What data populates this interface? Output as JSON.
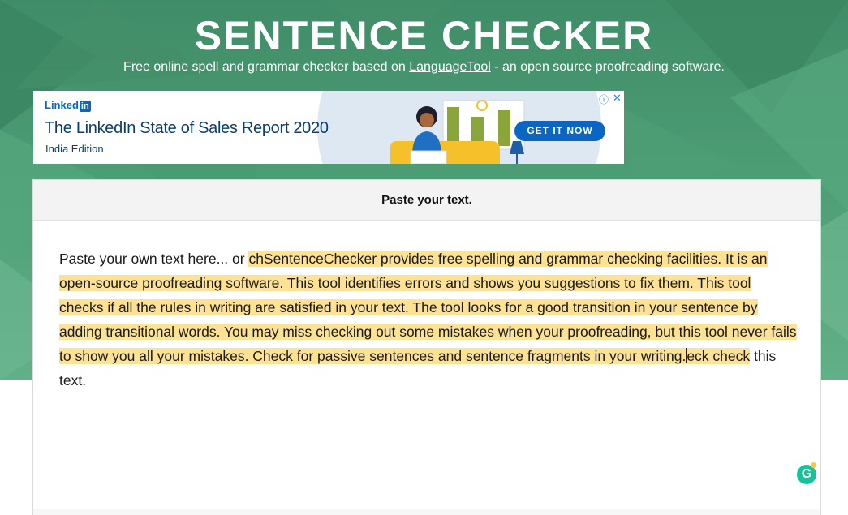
{
  "header": {
    "title": "SENTENCE CHECKER",
    "subtitle_prefix": "Free online spell and grammar checker based on ",
    "subtitle_link": "LanguageTool",
    "subtitle_suffix": " - an open source proofreading software."
  },
  "ad": {
    "brand_text": "Linked",
    "brand_badge": "in",
    "headline": "The LinkedIn State of Sales Report 2020",
    "edition": "India Edition",
    "cta": "GET IT NOW",
    "adchoices_icon": "info-icon",
    "close_icon": "close-icon"
  },
  "editor": {
    "heading": "Paste your text.",
    "text_plain_start": "Paste your own text here... or ",
    "text_highlighted": "chSentenceChecker provides free spelling and grammar checking facilities. It is an open-source proofreading software. This tool identifies errors and shows you suggestions to fix them. This tool checks if all the rules in writing are satisfied in your text. The tool looks for a good transition in your sentence by adding transitional words. You may miss checking out some mistakes when your proofreading, but this tool never fails to show you all your mistakes. Check for passive sentences and sentence fragments in your writing.",
    "text_highlighted_after_caret": "eck check",
    "text_plain_end": " this text.",
    "assistant_icon": "grammarly-icon",
    "assistant_letter": "G"
  },
  "colors": {
    "hero_green": "#4c9c74",
    "highlight": "#fde293",
    "linkedin_blue": "#0a66c2",
    "grammarly_green": "#15c39a"
  }
}
